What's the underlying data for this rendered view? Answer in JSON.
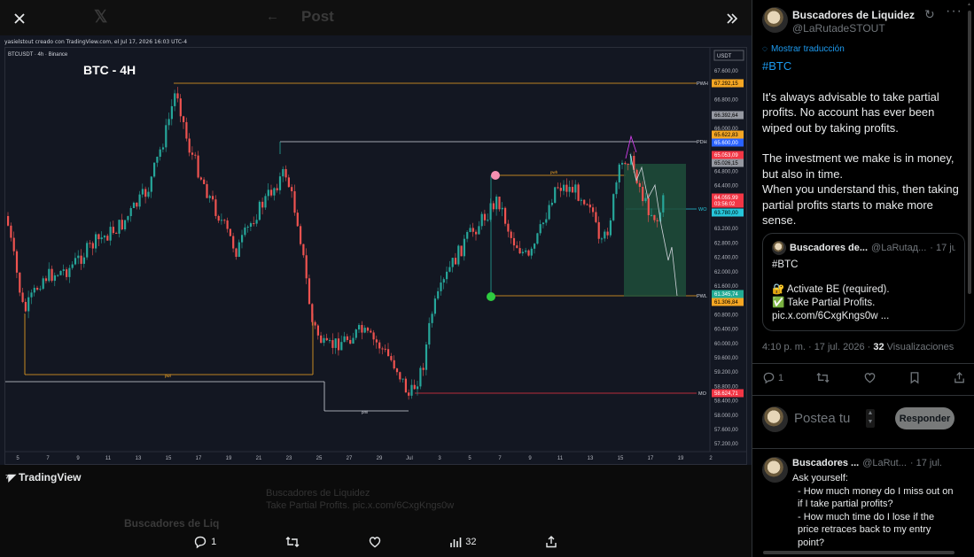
{
  "viewer": {
    "ghost_title": "Post",
    "ghost_notif_1": "Buscadores de Liquidez",
    "ghost_notif_2": "Take Partial Profits. pic.x.com/6CxgKngs0w",
    "ghost_name": "Buscadores de Liq"
  },
  "chart": {
    "credit": "yasielstout creado con TradingView.com, el Jul 17, 2026 16:03 UTC-4",
    "symbol": "BTCUSDT · 4h · Binance",
    "title": "BTC - 4H",
    "currency": "USDT",
    "brand": "TradingView",
    "y_ticks": [
      "67.600,00",
      "67.200,00",
      "66.800,00",
      "66.400,00",
      "66.000,00",
      "65.600,00",
      "65.200,00",
      "64.800,00",
      "64.400,00",
      "64.000,00",
      "63.600,00",
      "63.200,00",
      "62.800,00",
      "62.400,00",
      "62.000,00",
      "61.600,00",
      "61.200,00",
      "60.800,00",
      "60.400,00",
      "60.000,00",
      "59.600,00",
      "59.200,00",
      "58.800,00",
      "58.400,00",
      "58.000,00",
      "57.600,00",
      "57.200,00"
    ],
    "x_ticks": [
      "5",
      "7",
      "9",
      "11",
      "13",
      "15",
      "17",
      "19",
      "21",
      "23",
      "25",
      "27",
      "29",
      "Jul",
      "3",
      "5",
      "7",
      "9",
      "11",
      "13",
      "15",
      "17",
      "19",
      "2"
    ],
    "price_tags": [
      {
        "label": "67.292,15",
        "color": "#f5a623",
        "text": "#000"
      },
      {
        "label": "66.392,64",
        "color": "#9598a1",
        "text": "#000"
      },
      {
        "label": "65.622,83",
        "color": "#f5a623",
        "text": "#000"
      },
      {
        "label": "65.600,00",
        "color": "#2962ff",
        "text": "#fff"
      },
      {
        "label": "65.053,09",
        "color": "#f23645",
        "text": "#fff"
      },
      {
        "label": "65.026,15",
        "color": "#9598a1",
        "text": "#000"
      },
      {
        "label": "64.055,99",
        "color": "#f23645",
        "text": "#fff"
      },
      {
        "label": "03:56:02",
        "color": "#f23645",
        "text": "#fff"
      },
      {
        "label": "63.780,00",
        "color": "#26c6da",
        "text": "#000"
      },
      {
        "label": "61.345,74",
        "color": "#22ab94",
        "text": "#fff"
      },
      {
        "label": "61.306,84",
        "color": "#f5a623",
        "text": "#000"
      },
      {
        "label": "58.624,71",
        "color": "#f23645",
        "text": "#fff"
      }
    ],
    "level_labels": {
      "pwh": "PWH",
      "pdh": "PDH",
      "wo": "WO",
      "pwl": "PWL",
      "mo": "MO",
      "pwl_small": "pwl",
      "pml_small": "pml",
      "pwh_small": "pwh"
    },
    "colors": {
      "up": "#26a69a",
      "down": "#ef5350",
      "bg": "#131722"
    }
  },
  "actions": {
    "replies": "1",
    "views": "32"
  },
  "panel": {
    "author": "Buscadores de Liquidez",
    "handle": "@LaRutadeSTOUT",
    "translate": "Mostrar traducción",
    "hashtag": "#BTC",
    "para1": "It's always advisable to take partial profits. No account has ever been wiped out by taking profits.",
    "para2a": "The investment we make is in money, but also in time.",
    "para2b": "When you understand this, then taking partial profits starts to make more sense.",
    "quote": {
      "author": "Buscadores de...",
      "handle": "@LaRutaд...",
      "date": "· 17 jul.",
      "hashtag": "#BTC",
      "line1": "🔐 Activate BE (required).",
      "line2": "✅ Take Partial Profits.",
      "link": "pic.x.com/6CxgKngs0w ..."
    },
    "meta_time": "4:10 p. m. · 17 jul. 2026 · ",
    "meta_views_count": "32",
    "meta_views_label": " Visualizaciones",
    "reply_count": "1",
    "reply_placeholder": "Postea tu",
    "reply_button": "Responder",
    "reply2": {
      "author": "Buscadores ...",
      "handle": "@LaRut...",
      "date": "· 17 jul.",
      "text1": "Ask yourself:",
      "text2": "- How much money do I miss out on if I take partial profits?",
      "text3": "- How much time do I lose if the price retraces back to my entry point?"
    }
  }
}
